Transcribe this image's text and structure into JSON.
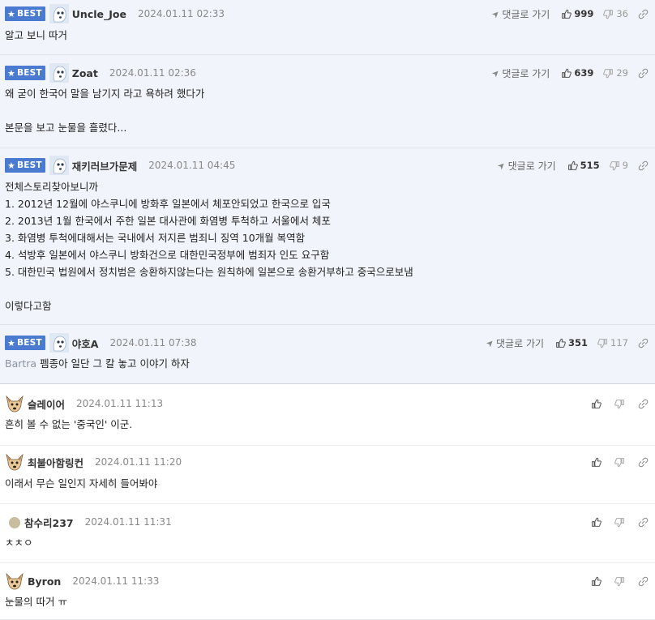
{
  "labels": {
    "best": "BEST",
    "reply_link": "댓글로 가기"
  },
  "comments": [
    {
      "best": true,
      "avatar": "ghost",
      "nick": "Uncle_Joe",
      "date": "2024.01.11 02:33",
      "up": "999",
      "down": "36",
      "lines": [
        "알고 보니 따거"
      ]
    },
    {
      "best": true,
      "avatar": "ghost",
      "nick": "Zoat",
      "date": "2024.01.11 02:36",
      "up": "639",
      "down": "29",
      "lines": [
        "왜 굳이 한국어 말을 남기지 라고 욕하려 했다가",
        "",
        "본문을 보고 눈물을 흘렸다..."
      ]
    },
    {
      "best": true,
      "avatar": "ghost",
      "nick": "재키러브가문제",
      "date": "2024.01.11 04:45",
      "up": "515",
      "down": "9",
      "lines": [
        "전체스토리찾아보니까",
        "1. 2012년 12월에 야스쿠니에 방화후 일본에서 체포안되었고 한국으로 입국",
        "2. 2013년 1월 한국에서 주한 일본 대사관에 화염병 투척하고 서울에서 체포",
        "3. 화염병 투척에대해서는 국내에서 저지른 범죄니 징역 10개월 복역함",
        "4. 석방후 일본에서 야스쿠니 방화건으로 대한민국정부에 범죄자 인도 요구함",
        "5. 대한민국 법원에서 정치범은 송환하지않는다는 원칙하에 일본으로 송환거부하고 중국으로보냄",
        "",
        "이렇다고함"
      ]
    },
    {
      "best": true,
      "avatar": "ghost",
      "nick": "야호A",
      "date": "2024.01.11 07:38",
      "up": "351",
      "down": "117",
      "reply_to": "Bartra",
      "lines": [
        "펨종아 일단 그 칼 놓고 이야기 하자"
      ]
    },
    {
      "best": false,
      "avatar": "dog",
      "nick": "슬레이어",
      "date": "2024.01.11 11:13",
      "lines": [
        "흔히 볼 수 없는 '중국인' 이군."
      ]
    },
    {
      "best": false,
      "avatar": "dog",
      "nick": "최불아함링컨",
      "date": "2024.01.11 11:20",
      "lines": [
        "이래서 무슨 일인지 자세히 들어봐야"
      ]
    },
    {
      "best": false,
      "avatar": "dot",
      "nick": "참수리237",
      "date": "2024.01.11 11:31",
      "lines": [
        "ㅊㅊㅇ"
      ]
    },
    {
      "best": false,
      "avatar": "dog",
      "nick": "Byron",
      "date": "2024.01.11 11:33",
      "lines": [
        "눈물의 따거 ㅠ"
      ]
    }
  ]
}
